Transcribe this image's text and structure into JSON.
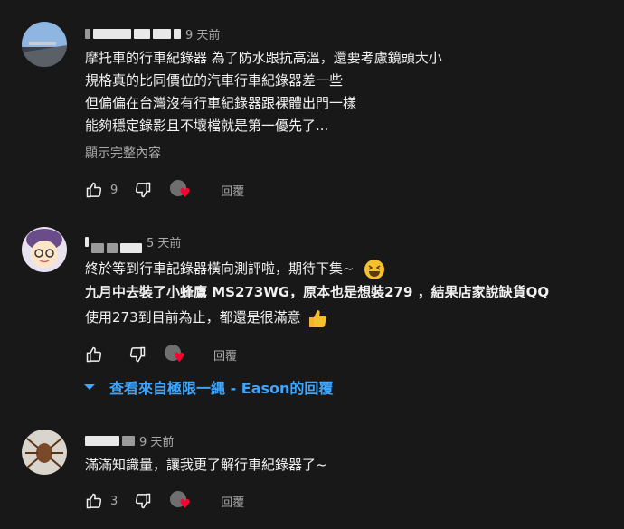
{
  "comments": [
    {
      "time": "9 天前",
      "lines": [
        "摩托車的行車紀錄器 為了防水跟抗高溫，還要考慮鏡頭大小",
        "規格真的比同價位的汽車行車紀錄器差一些",
        "但偏偏在台灣沒有行車紀錄器跟裸體出門一樣",
        "能夠穩定錄影且不壞檔就是第一優先了..."
      ],
      "show_more": "顯示完整內容",
      "likes": "9",
      "reply_label": "回覆"
    },
    {
      "time": "5 天前",
      "lines": [
        "終於等到行車記錄器橫向測評啦，期待下集~",
        "九月中去裝了小蜂鷹 MS273WG，原本也是想裝279 ，結果店家說缺貨QQ",
        "使用273到目前為止，都還是很滿意"
      ],
      "reply_label": "回覆",
      "view_replies": "查看來自極限一縄 - Eason的回覆"
    },
    {
      "time": "9 天前",
      "lines": [
        "滿滿知識量，讓我更了解行車紀錄器了~"
      ],
      "likes": "3",
      "reply_label": "回覆"
    }
  ],
  "icons": {
    "like": "thumbs-up-icon",
    "dislike": "thumbs-down-icon",
    "creator_heart": "creator-heart-icon",
    "expand": "chevron-down-icon"
  },
  "colors": {
    "background": "#181818",
    "text": "#f1f1f1",
    "secondary": "#aaaaaa",
    "link": "#3ea6ff",
    "heart": "#ff0033"
  }
}
